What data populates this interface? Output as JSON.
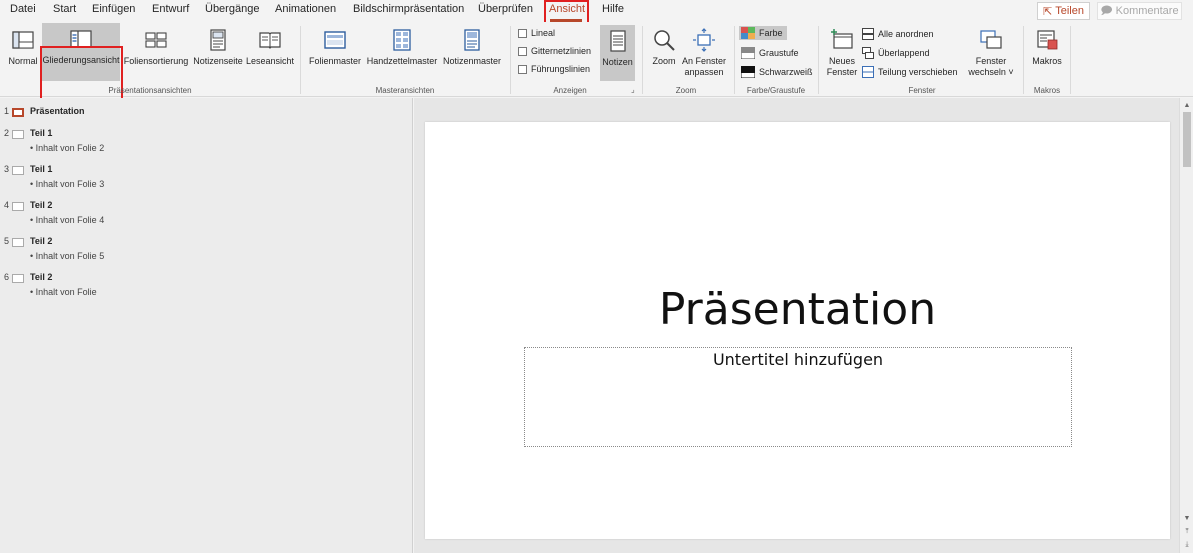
{
  "menu": {
    "tabs": [
      "Datei",
      "Start",
      "Einfügen",
      "Entwurf",
      "Übergänge",
      "Animationen",
      "Bildschirmpräsentation",
      "Überprüfen",
      "Ansicht",
      "Hilfe"
    ],
    "active_tab": "Ansicht",
    "share_label": "Teilen",
    "comments_label": "Kommentare"
  },
  "ribbon": {
    "presentation_views": {
      "group_label": "Präsentationsansichten",
      "normal": "Normal",
      "outline": "Gliederungsansicht",
      "slide_sorter": "Foliensortierung",
      "notes_page": "Notizenseite",
      "reading_view": "Leseansicht"
    },
    "master_views": {
      "group_label": "Masteransichten",
      "slide_master": "Folienmaster",
      "handout_master": "Handzettelmaster",
      "notes_master": "Notizenmaster"
    },
    "show": {
      "group_label": "Anzeigen",
      "ruler": "Lineal",
      "gridlines": "Gitternetzlinien",
      "guides": "Führungslinien",
      "notes": "Notizen"
    },
    "zoom": {
      "group_label": "Zoom",
      "zoom": "Zoom",
      "fit_line1": "An Fenster",
      "fit_line2": "anpassen"
    },
    "color": {
      "group_label": "Farbe/Graustufe",
      "color": "Farbe",
      "grayscale": "Graustufe",
      "bw": "Schwarzweiß"
    },
    "window": {
      "group_label": "Fenster",
      "new_line1": "Neues",
      "new_line2": "Fenster",
      "arrange_all": "Alle anordnen",
      "cascade": "Überlappend",
      "move_split": "Teilung verschieben",
      "switch_line1": "Fenster",
      "switch_line2": "wechseln ˅"
    },
    "macros": {
      "group_label": "Makros",
      "macros": "Makros"
    }
  },
  "outline": {
    "slides": [
      {
        "num": "1",
        "title": "Präsentation",
        "bullet": ""
      },
      {
        "num": "2",
        "title": "Teil 1",
        "bullet": "• Inhalt von Folie 2"
      },
      {
        "num": "3",
        "title": "Teil 1",
        "bullet": "• Inhalt von Folie 3"
      },
      {
        "num": "4",
        "title": "Teil 2",
        "bullet": "• Inhalt von Folie 4"
      },
      {
        "num": "5",
        "title": "Teil 2",
        "bullet": "• Inhalt von Folie 5"
      },
      {
        "num": "6",
        "title": "Teil 2",
        "bullet": "• Inhalt von Folie"
      }
    ]
  },
  "slide": {
    "title": "Präsentation",
    "subtitle_placeholder": "Untertitel hinzufügen"
  },
  "colors": {
    "accent": "#b7472a",
    "highlight_box": "#e02020"
  }
}
